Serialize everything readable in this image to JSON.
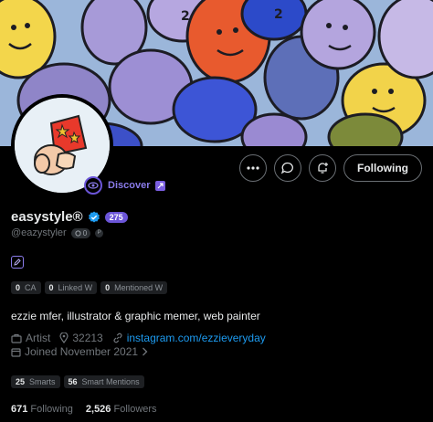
{
  "colors": {
    "accent_purple": "#6b55d8",
    "link_blue": "#1d9bf0",
    "verified_blue": "#1d9bf0"
  },
  "discover": {
    "label": "Discover"
  },
  "actions": {
    "more_icon": "more-horizontal-icon",
    "message_icon": "message-bubble-icon",
    "notify_icon": "bell-plus-icon",
    "follow_label": "Following"
  },
  "profile": {
    "display_name": "easystyle®",
    "score": "275",
    "handle": "@eazystyler",
    "handle_badge_count": "0",
    "handle_badge_extra": "P"
  },
  "stats": [
    {
      "num": "0",
      "label": "CA"
    },
    {
      "num": "0",
      "label": "Linked W"
    },
    {
      "num": "0",
      "label": "Mentioned W"
    }
  ],
  "bio": "ezzie mfer, illustrator & graphic memer, web painter",
  "meta": {
    "category": "Artist",
    "location": "32213",
    "link": "instagram.com/ezzieveryday",
    "joined": "Joined November 2021"
  },
  "smart": [
    {
      "num": "25",
      "label": "Smarts"
    },
    {
      "num": "56",
      "label": "Smart Mentions"
    }
  ],
  "follows": {
    "following_num": "671",
    "following_label": "Following",
    "followers_num": "2,526",
    "followers_label": "Followers"
  }
}
